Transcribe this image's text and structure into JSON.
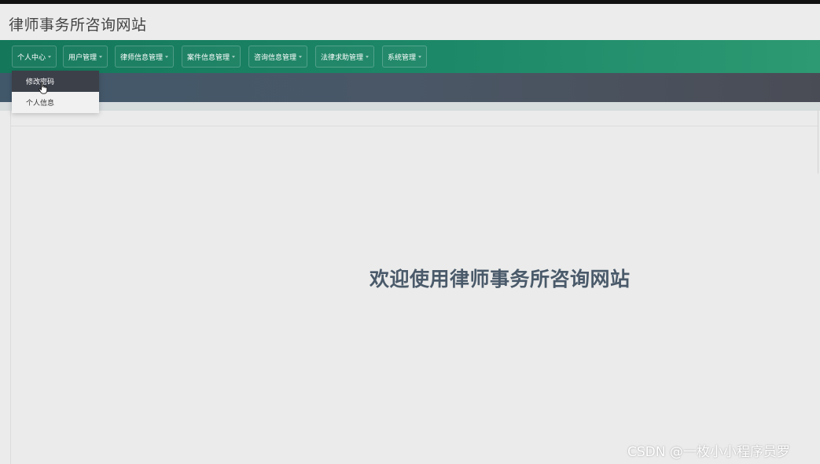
{
  "header": {
    "title": "律师事务所咨询网站"
  },
  "nav": {
    "items": [
      {
        "label": "个人中心"
      },
      {
        "label": "用户管理"
      },
      {
        "label": "律师信息管理"
      },
      {
        "label": "案件信息管理"
      },
      {
        "label": "咨询信息管理"
      },
      {
        "label": "法律求助管理"
      },
      {
        "label": "系统管理"
      }
    ]
  },
  "dropdown": {
    "items": [
      {
        "label": "修改密码",
        "state": "hover"
      },
      {
        "label": "个人信息"
      }
    ]
  },
  "main": {
    "welcome": "欢迎使用律师事务所咨询网站"
  },
  "watermark": "CSDN @一枚小小程序员罗",
  "colors": {
    "navbar": "#1e8a69",
    "banner": "#4a5766",
    "dropdown_active": "#3c4049",
    "welcome_text": "#4a5a6a"
  },
  "icons": {
    "cursor": "hand-pointer-icon",
    "caret": "caret-down-icon"
  }
}
